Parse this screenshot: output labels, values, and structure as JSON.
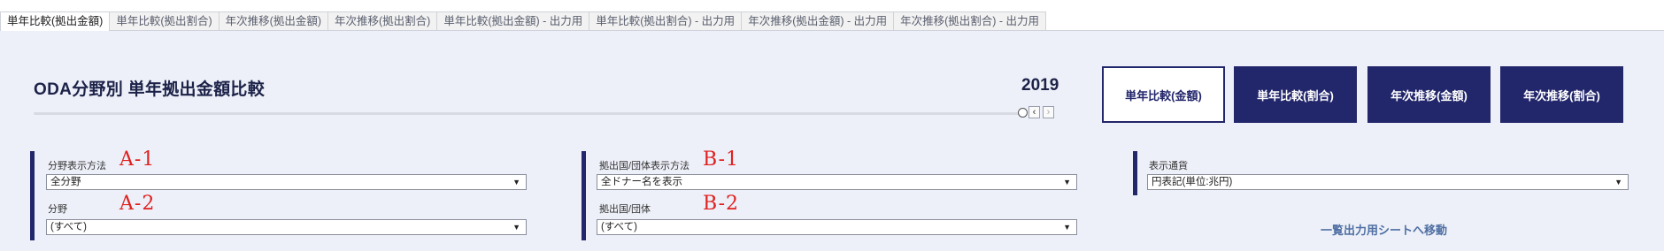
{
  "tabs": [
    "単年比較(拠出金額)",
    "単年比較(拠出割合)",
    "年次推移(拠出金額)",
    "年次推移(拠出割合)",
    "単年比較(拠出金額) - 出力用",
    "単年比較(拠出割合) - 出力用",
    "年次推移(拠出金額) - 出力用",
    "年次推移(拠出割合) - 出力用"
  ],
  "header": {
    "title": "ODA分野別 単年拠出金額比較",
    "year": "2019"
  },
  "view_buttons": [
    "単年比較(金額)",
    "単年比較(割合)",
    "年次推移(金額)",
    "年次推移(割合)"
  ],
  "filters": {
    "field_display": {
      "label": "分野表示方法",
      "value": "全分野",
      "annot": "A-1"
    },
    "field": {
      "label": "分野",
      "value": "(すべて)",
      "annot": "A-2"
    },
    "donor_display": {
      "label": "拠出国/団体表示方法",
      "value": "全ドナー名を表示",
      "annot": "B-1"
    },
    "donor": {
      "label": "拠出国/団体",
      "value": "(すべて)",
      "annot": "B-2"
    },
    "currency": {
      "label": "表示通貨",
      "value": "円表記(単位:兆円)"
    }
  },
  "link_label": "一覧出力用シートへ移動",
  "colors": {
    "accent": "#22266b",
    "annotation": "#e0201f",
    "link": "#4f6fa3"
  }
}
